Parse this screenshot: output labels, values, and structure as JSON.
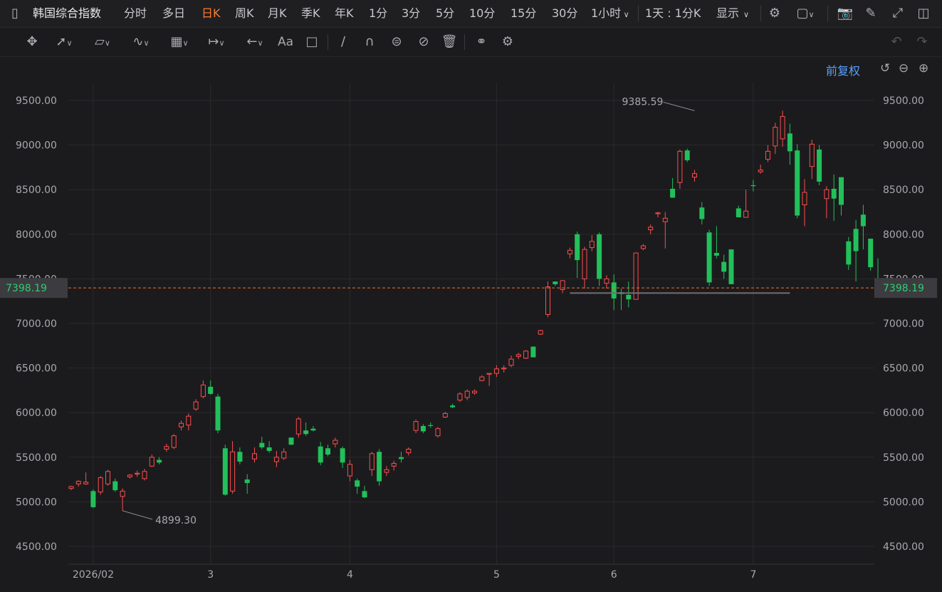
{
  "topbar": {
    "title": "韩国综合指数",
    "periods": [
      "分时",
      "多日",
      "日K",
      "周K",
      "月K",
      "季K",
      "年K",
      "1分",
      "3分",
      "5分",
      "10分",
      "15分",
      "30分",
      "1小时"
    ],
    "active_period": "日K",
    "range_label": "1天 : 1分K",
    "display_label": "显示"
  },
  "controls": {
    "adjust_label": "前复权"
  },
  "colors": {
    "up": "#ff4d4d",
    "down": "#22c05a",
    "current_line": "#ff6a2a",
    "current_badge_bg": "#3c3c40",
    "current_badge_text": "#2ecc71"
  },
  "chart_data": {
    "type": "candlestick",
    "title": "",
    "xlabel": "",
    "ylabel": "",
    "ylim": [
      4300,
      9700
    ],
    "y_ticks": [
      4500,
      5000,
      5500,
      6000,
      6500,
      7000,
      7500,
      8000,
      8500,
      9000,
      9500
    ],
    "y_tick_labels": [
      "4500.00",
      "5000.00",
      "5500.00",
      "6000.00",
      "6500.00",
      "7000.00",
      "7500.00",
      "8000.00",
      "8500.00",
      "9000.00",
      "9500.00"
    ],
    "x_labels": [
      {
        "label": "2026/02",
        "index": 3
      },
      {
        "label": "3",
        "index": 19
      },
      {
        "label": "4",
        "index": 38
      },
      {
        "label": "5",
        "index": 58
      },
      {
        "label": "6",
        "index": 74
      },
      {
        "label": "7",
        "index": 93
      }
    ],
    "current_price": 7398.19,
    "current_price_label": "7398.19",
    "high_marker": {
      "value": 9385.59,
      "label": "9385.59",
      "index": 85
    },
    "low_marker": {
      "value": 4899.3,
      "label": "4899.30",
      "index": 7
    },
    "support_line": {
      "value": 7340,
      "from_index": 68,
      "to_index": 98
    },
    "candles": [
      [
        5150,
        5180,
        5130,
        5170
      ],
      [
        5200,
        5240,
        5170,
        5230
      ],
      [
        5200,
        5330,
        5190,
        5220
      ],
      [
        5120,
        5140,
        4930,
        4940
      ],
      [
        5110,
        5290,
        5080,
        5270
      ],
      [
        5200,
        5360,
        5180,
        5340
      ],
      [
        5230,
        5260,
        5110,
        5130
      ],
      [
        5060,
        5150,
        4899,
        5120
      ],
      [
        5280,
        5310,
        5260,
        5300
      ],
      [
        5310,
        5350,
        5280,
        5320
      ],
      [
        5260,
        5370,
        5240,
        5340
      ],
      [
        5400,
        5530,
        5390,
        5500
      ],
      [
        5470,
        5500,
        5420,
        5440
      ],
      [
        5590,
        5650,
        5560,
        5620
      ],
      [
        5610,
        5760,
        5590,
        5740
      ],
      [
        5840,
        5910,
        5800,
        5880
      ],
      [
        5860,
        5990,
        5800,
        5960
      ],
      [
        6040,
        6150,
        6020,
        6120
      ],
      [
        6180,
        6360,
        6160,
        6310
      ],
      [
        6290,
        6360,
        6200,
        6210
      ],
      [
        6180,
        6210,
        5770,
        5800
      ],
      [
        5600,
        5640,
        5070,
        5080
      ],
      [
        5120,
        5680,
        5090,
        5560
      ],
      [
        5560,
        5610,
        5420,
        5450
      ],
      [
        5250,
        5310,
        5090,
        5210
      ],
      [
        5480,
        5610,
        5440,
        5540
      ],
      [
        5660,
        5730,
        5590,
        5610
      ],
      [
        5610,
        5680,
        5550,
        5570
      ],
      [
        5450,
        5570,
        5390,
        5500
      ],
      [
        5490,
        5600,
        5470,
        5560
      ],
      [
        5720,
        5710,
        5640,
        5640
      ],
      [
        5760,
        5950,
        5720,
        5930
      ],
      [
        5800,
        5890,
        5740,
        5760
      ],
      [
        5820,
        5850,
        5790,
        5800
      ],
      [
        5620,
        5670,
        5410,
        5440
      ],
      [
        5600,
        5640,
        5510,
        5530
      ],
      [
        5650,
        5720,
        5610,
        5690
      ],
      [
        5600,
        5620,
        5380,
        5440
      ],
      [
        5290,
        5470,
        5230,
        5420
      ],
      [
        5240,
        5260,
        5090,
        5170
      ],
      [
        5120,
        5180,
        5040,
        5050
      ],
      [
        5360,
        5560,
        5290,
        5540
      ],
      [
        5560,
        5590,
        5180,
        5230
      ],
      [
        5330,
        5400,
        5290,
        5360
      ],
      [
        5400,
        5460,
        5350,
        5430
      ],
      [
        5500,
        5560,
        5440,
        5480
      ],
      [
        5550,
        5610,
        5520,
        5590
      ],
      [
        5800,
        5920,
        5770,
        5900
      ],
      [
        5850,
        5870,
        5770,
        5790
      ],
      [
        5860,
        5890,
        5830,
        5850
      ],
      [
        5740,
        5840,
        5720,
        5820
      ],
      [
        5950,
        6010,
        5940,
        5990
      ],
      [
        6080,
        6100,
        6050,
        6060
      ],
      [
        6140,
        6230,
        6120,
        6210
      ],
      [
        6170,
        6260,
        6140,
        6240
      ],
      [
        6220,
        6260,
        6200,
        6240
      ],
      [
        6360,
        6420,
        6350,
        6400
      ],
      [
        6430,
        6440,
        6300,
        6440
      ],
      [
        6440,
        6530,
        6400,
        6490
      ],
      [
        6490,
        6530,
        6450,
        6500
      ],
      [
        6530,
        6640,
        6510,
        6600
      ],
      [
        6630,
        6670,
        6600,
        6650
      ],
      [
        6610,
        6700,
        6600,
        6690
      ],
      [
        6740,
        6700,
        6620,
        6620
      ],
      [
        6880,
        6930,
        6870,
        6920
      ],
      [
        7100,
        7470,
        7070,
        7410
      ],
      [
        7470,
        7460,
        7420,
        7440
      ],
      [
        7380,
        7480,
        7340,
        7480
      ],
      [
        7780,
        7850,
        7730,
        7820
      ],
      [
        8000,
        8030,
        7510,
        7710
      ],
      [
        7500,
        7860,
        7390,
        7830
      ],
      [
        7850,
        7990,
        7810,
        7920
      ],
      [
        8000,
        8020,
        7420,
        7500
      ],
      [
        7450,
        7540,
        7390,
        7500
      ],
      [
        7460,
        7550,
        7150,
        7280
      ],
      [
        7350,
        7390,
        7150,
        7330
      ],
      [
        7320,
        7470,
        7180,
        7270
      ],
      [
        7270,
        7790,
        7270,
        7790
      ],
      [
        7840,
        7890,
        7820,
        7870
      ],
      [
        8050,
        8110,
        8000,
        8080
      ],
      [
        8230,
        8250,
        8190,
        8240
      ],
      [
        8140,
        8250,
        7840,
        8180
      ],
      [
        8510,
        8630,
        8410,
        8410
      ],
      [
        8580,
        8950,
        8510,
        8930
      ],
      [
        8940,
        8960,
        8810,
        8830
      ],
      [
        8640,
        8720,
        8590,
        8680
      ],
      [
        8300,
        8360,
        8110,
        8170
      ],
      [
        8020,
        8050,
        7420,
        7460
      ],
      [
        7790,
        8090,
        7730,
        7760
      ],
      [
        7690,
        7770,
        7500,
        7580
      ],
      [
        7830,
        7730,
        7440,
        7440
      ],
      [
        8290,
        8320,
        8200,
        8190
      ],
      [
        8190,
        8500,
        8190,
        8260
      ],
      [
        8550,
        8610,
        8480,
        8540
      ],
      [
        8700,
        8780,
        8680,
        8720
      ],
      [
        8840,
        9000,
        8810,
        8930
      ],
      [
        8990,
        9250,
        8900,
        9200
      ],
      [
        9070,
        9386,
        8980,
        9320
      ],
      [
        9130,
        9240,
        8780,
        8930
      ],
      [
        8940,
        9010,
        8180,
        8210
      ],
      [
        8330,
        8620,
        8090,
        8470
      ],
      [
        8760,
        9060,
        8620,
        9010
      ],
      [
        8950,
        9000,
        8550,
        8590
      ],
      [
        8400,
        8540,
        8180,
        8500
      ],
      [
        8510,
        8670,
        8150,
        8400
      ],
      [
        8640,
        8620,
        8210,
        8330
      ],
      [
        7920,
        7970,
        7600,
        7660
      ],
      [
        8060,
        8160,
        7470,
        7810
      ],
      [
        8220,
        8330,
        7830,
        8090
      ],
      [
        7950,
        7860,
        7590,
        7630
      ],
      [
        7440,
        7730,
        7400,
        7398
      ]
    ]
  }
}
